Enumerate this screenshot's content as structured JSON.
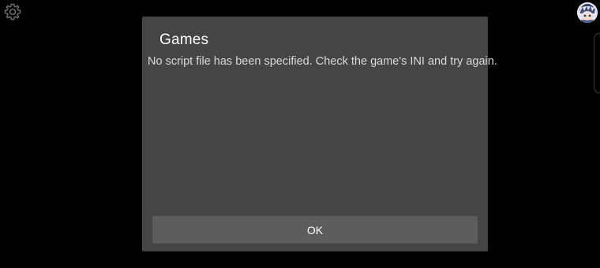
{
  "dialog": {
    "title": "Games",
    "message": "No script file has been specified. Check the game's INI and try again.",
    "ok_label": "OK"
  },
  "icons": {
    "settings": "gear-icon",
    "avatar": "user-avatar"
  },
  "colors": {
    "background": "#000000",
    "dialog_bg": "#454545",
    "button_bg": "#5d5d5d",
    "title_text": "#ffffff",
    "message_text": "#dadada"
  }
}
